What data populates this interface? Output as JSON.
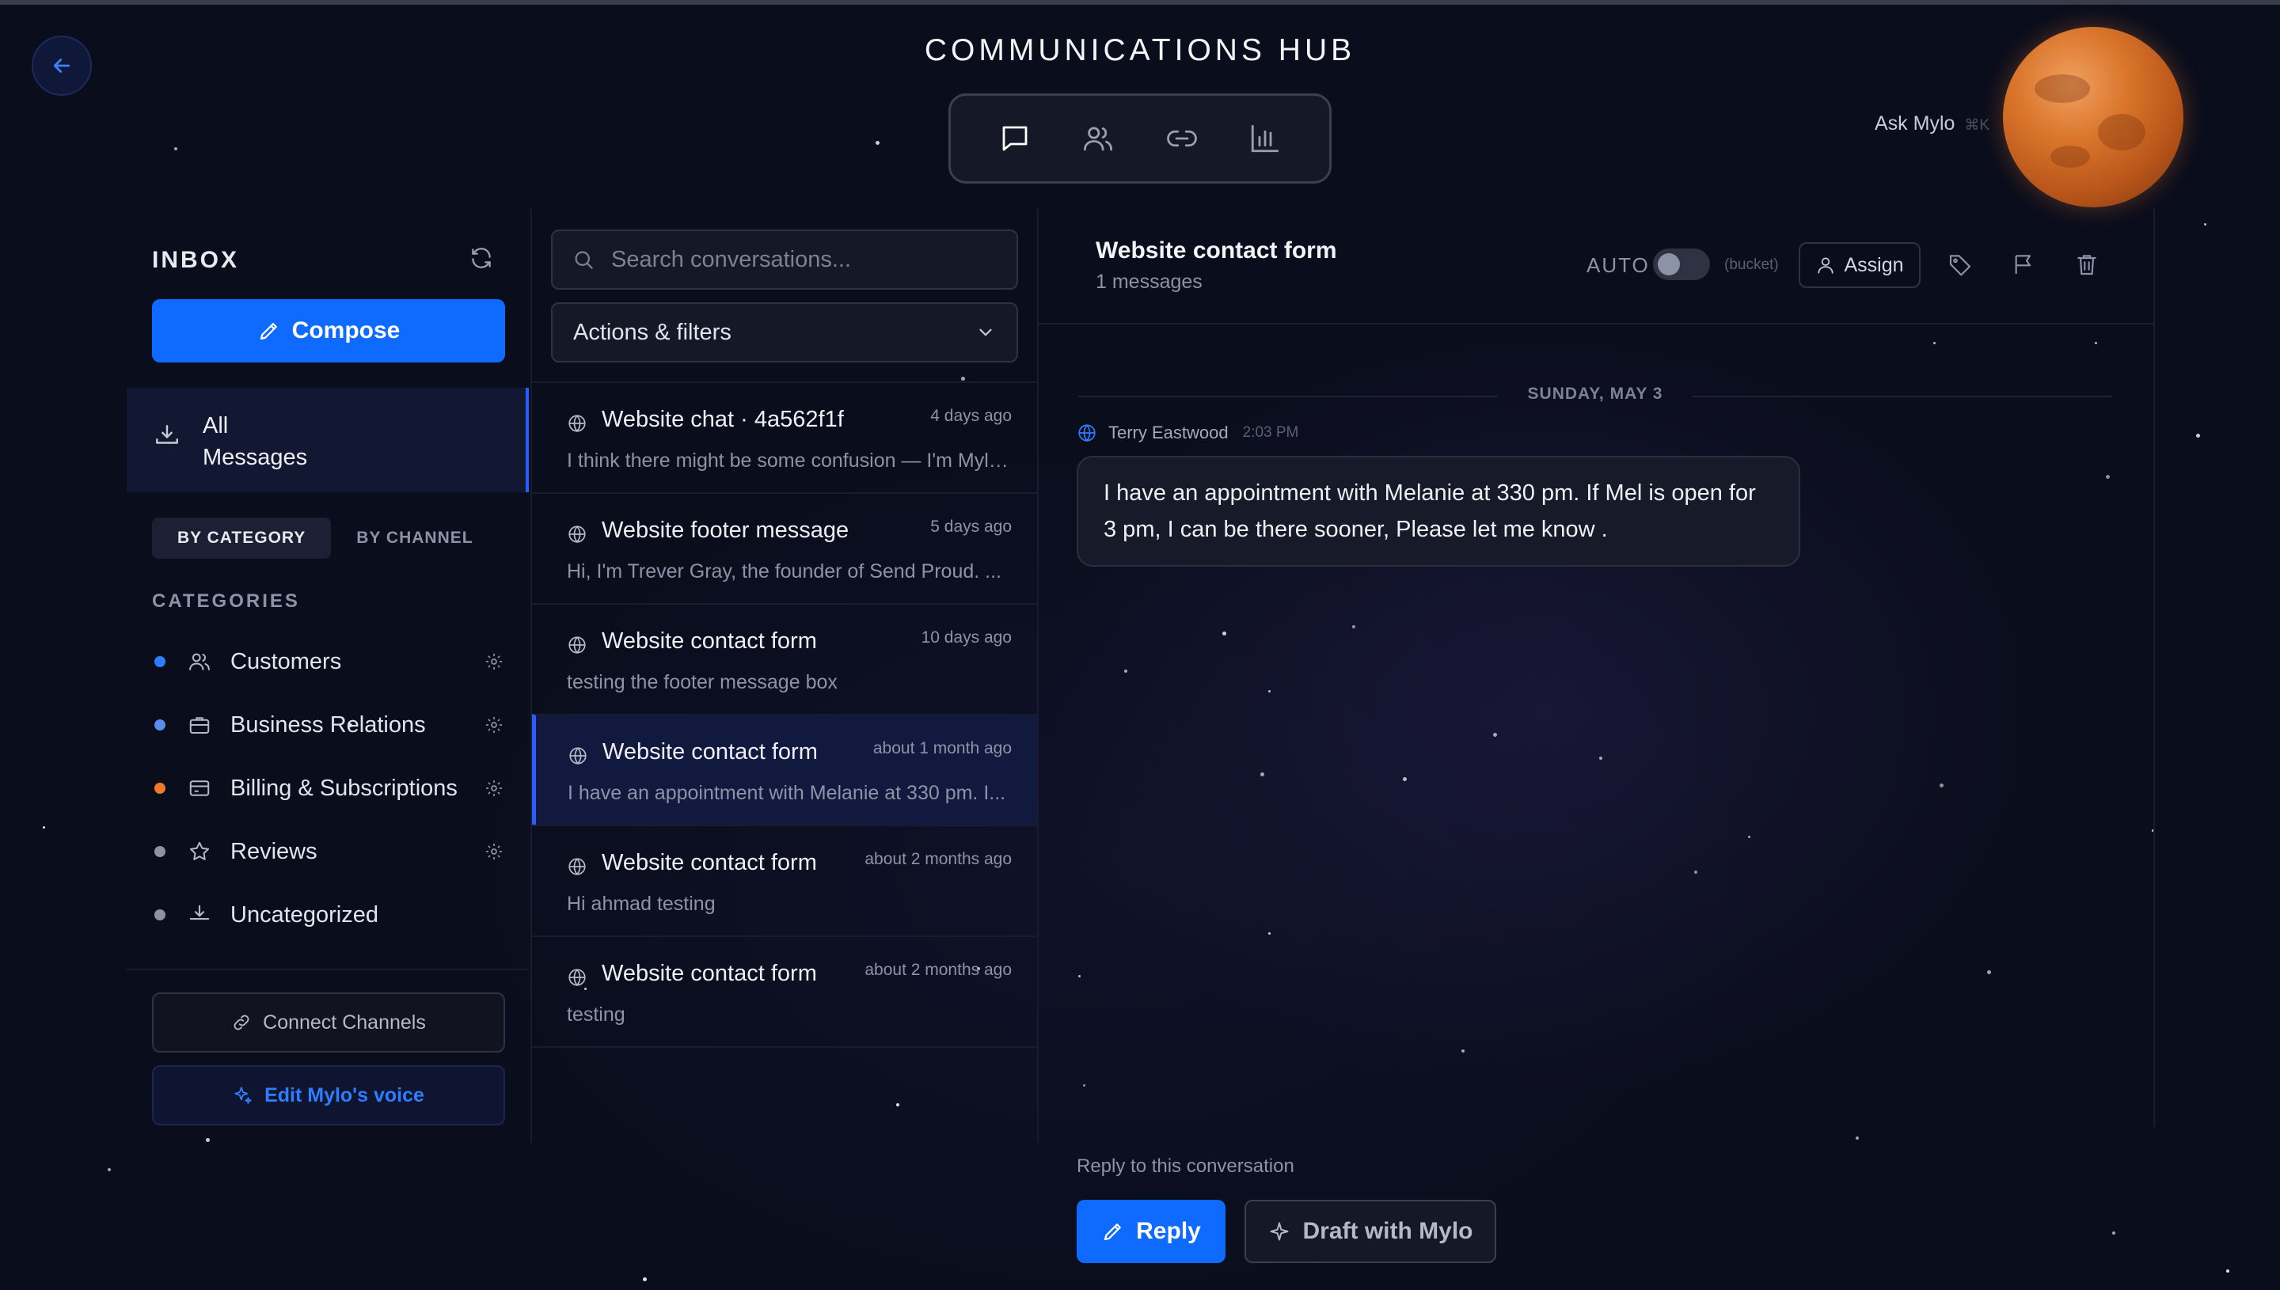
{
  "header": {
    "title": "COMMUNICATIONS HUB",
    "ask": "Ask Mylo",
    "ask_shortcut": "⌘K",
    "tabs": [
      {
        "icon": "chat-bubble-icon",
        "active": true
      },
      {
        "icon": "users-icon"
      },
      {
        "icon": "link-icon"
      },
      {
        "icon": "bar-chart-icon"
      }
    ]
  },
  "sidebar": {
    "title": "INBOX",
    "compose_label": "Compose",
    "all_messages_label": "All Messages",
    "tabs": [
      "BY CATEGORY",
      "BY CHANNEL"
    ],
    "categories_header": "CATEGORIES",
    "categories": [
      {
        "label": "Customers",
        "color": "#2f7dff",
        "icon": "users-icon"
      },
      {
        "label": "Business Relations",
        "color": "#5b8cf0",
        "icon": "briefcase-icon"
      },
      {
        "label": "Billing & Subscriptions",
        "color": "#f07a2a",
        "icon": "credit-card-icon"
      },
      {
        "label": "Reviews",
        "color": "#8d93a6",
        "icon": "star-icon"
      },
      {
        "label": "Uncategorized",
        "color": "#8d93a6",
        "icon": "inbox-download-icon"
      }
    ],
    "connect_label": "Connect Channels",
    "voice_label": "Edit Mylo's voice"
  },
  "conversations": {
    "search_placeholder": "Search conversations...",
    "filters_label": "Actions & filters",
    "items": [
      {
        "title": "Website chat · 4a562f1f",
        "time": "4 days ago",
        "preview": "I think there might be some confusion — I'm Mylo, your AI assistant"
      },
      {
        "title": "Website footer message",
        "time": "5 days ago",
        "preview": "Hi, I'm Trever Gray, the founder of Send Proud. ..."
      },
      {
        "title": "Website contact form",
        "time": "10 days ago",
        "preview": "testing the footer message box"
      },
      {
        "title": "Website contact form",
        "time": "about 1 month ago",
        "preview": "I have an appointment with Melanie at 330 pm. I...",
        "selected": true
      },
      {
        "title": "Website contact form",
        "time": "about 2 months ago",
        "preview": "Hi ahmad testing"
      },
      {
        "title": "Website contact form",
        "time": "about 2 months ago",
        "preview": "testing"
      }
    ]
  },
  "message": {
    "title": "Website contact form",
    "count": "1 messages",
    "auto_label": "AUTO",
    "bucket_label": "(bucket)",
    "assign_label": "Assign",
    "date_separator": "SUNDAY, MAY 3",
    "sender": "Terry Eastwood",
    "sent_time": "2:03 PM",
    "body": "I have an appointment with Melanie at 330 pm. If Mel is open for 3 pm, I can be there sooner, Please let me know .",
    "reply_hint": "Reply to this conversation",
    "reply_label": "Reply",
    "draft_label": "Draft with Mylo"
  }
}
